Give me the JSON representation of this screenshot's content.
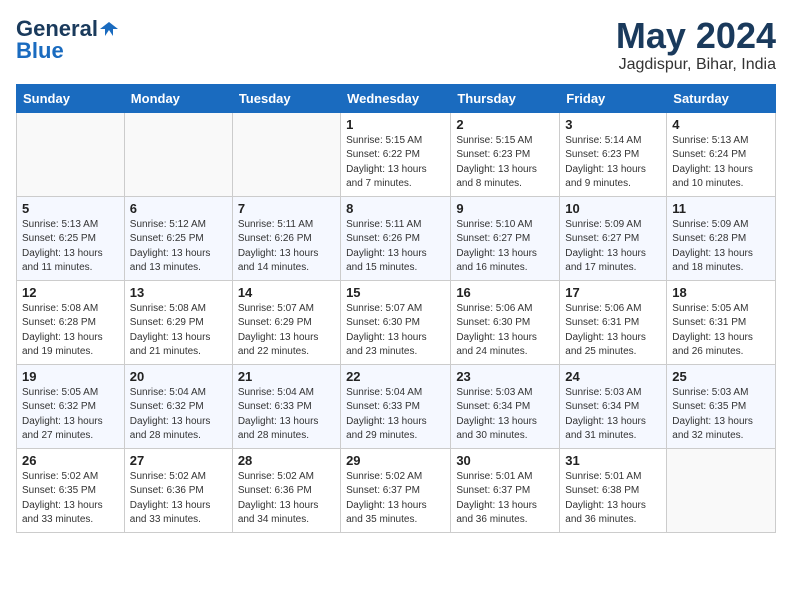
{
  "logo": {
    "line1": "General",
    "line2": "Blue"
  },
  "title": {
    "month_year": "May 2024",
    "location": "Jagdispur, Bihar, India"
  },
  "days_of_week": [
    "Sunday",
    "Monday",
    "Tuesday",
    "Wednesday",
    "Thursday",
    "Friday",
    "Saturday"
  ],
  "weeks": [
    [
      {
        "day": "",
        "info": ""
      },
      {
        "day": "",
        "info": ""
      },
      {
        "day": "",
        "info": ""
      },
      {
        "day": "1",
        "info": "Sunrise: 5:15 AM\nSunset: 6:22 PM\nDaylight: 13 hours\nand 7 minutes."
      },
      {
        "day": "2",
        "info": "Sunrise: 5:15 AM\nSunset: 6:23 PM\nDaylight: 13 hours\nand 8 minutes."
      },
      {
        "day": "3",
        "info": "Sunrise: 5:14 AM\nSunset: 6:23 PM\nDaylight: 13 hours\nand 9 minutes."
      },
      {
        "day": "4",
        "info": "Sunrise: 5:13 AM\nSunset: 6:24 PM\nDaylight: 13 hours\nand 10 minutes."
      }
    ],
    [
      {
        "day": "5",
        "info": "Sunrise: 5:13 AM\nSunset: 6:25 PM\nDaylight: 13 hours\nand 11 minutes."
      },
      {
        "day": "6",
        "info": "Sunrise: 5:12 AM\nSunset: 6:25 PM\nDaylight: 13 hours\nand 13 minutes."
      },
      {
        "day": "7",
        "info": "Sunrise: 5:11 AM\nSunset: 6:26 PM\nDaylight: 13 hours\nand 14 minutes."
      },
      {
        "day": "8",
        "info": "Sunrise: 5:11 AM\nSunset: 6:26 PM\nDaylight: 13 hours\nand 15 minutes."
      },
      {
        "day": "9",
        "info": "Sunrise: 5:10 AM\nSunset: 6:27 PM\nDaylight: 13 hours\nand 16 minutes."
      },
      {
        "day": "10",
        "info": "Sunrise: 5:09 AM\nSunset: 6:27 PM\nDaylight: 13 hours\nand 17 minutes."
      },
      {
        "day": "11",
        "info": "Sunrise: 5:09 AM\nSunset: 6:28 PM\nDaylight: 13 hours\nand 18 minutes."
      }
    ],
    [
      {
        "day": "12",
        "info": "Sunrise: 5:08 AM\nSunset: 6:28 PM\nDaylight: 13 hours\nand 19 minutes."
      },
      {
        "day": "13",
        "info": "Sunrise: 5:08 AM\nSunset: 6:29 PM\nDaylight: 13 hours\nand 21 minutes."
      },
      {
        "day": "14",
        "info": "Sunrise: 5:07 AM\nSunset: 6:29 PM\nDaylight: 13 hours\nand 22 minutes."
      },
      {
        "day": "15",
        "info": "Sunrise: 5:07 AM\nSunset: 6:30 PM\nDaylight: 13 hours\nand 23 minutes."
      },
      {
        "day": "16",
        "info": "Sunrise: 5:06 AM\nSunset: 6:30 PM\nDaylight: 13 hours\nand 24 minutes."
      },
      {
        "day": "17",
        "info": "Sunrise: 5:06 AM\nSunset: 6:31 PM\nDaylight: 13 hours\nand 25 minutes."
      },
      {
        "day": "18",
        "info": "Sunrise: 5:05 AM\nSunset: 6:31 PM\nDaylight: 13 hours\nand 26 minutes."
      }
    ],
    [
      {
        "day": "19",
        "info": "Sunrise: 5:05 AM\nSunset: 6:32 PM\nDaylight: 13 hours\nand 27 minutes."
      },
      {
        "day": "20",
        "info": "Sunrise: 5:04 AM\nSunset: 6:32 PM\nDaylight: 13 hours\nand 28 minutes."
      },
      {
        "day": "21",
        "info": "Sunrise: 5:04 AM\nSunset: 6:33 PM\nDaylight: 13 hours\nand 28 minutes."
      },
      {
        "day": "22",
        "info": "Sunrise: 5:04 AM\nSunset: 6:33 PM\nDaylight: 13 hours\nand 29 minutes."
      },
      {
        "day": "23",
        "info": "Sunrise: 5:03 AM\nSunset: 6:34 PM\nDaylight: 13 hours\nand 30 minutes."
      },
      {
        "day": "24",
        "info": "Sunrise: 5:03 AM\nSunset: 6:34 PM\nDaylight: 13 hours\nand 31 minutes."
      },
      {
        "day": "25",
        "info": "Sunrise: 5:03 AM\nSunset: 6:35 PM\nDaylight: 13 hours\nand 32 minutes."
      }
    ],
    [
      {
        "day": "26",
        "info": "Sunrise: 5:02 AM\nSunset: 6:35 PM\nDaylight: 13 hours\nand 33 minutes."
      },
      {
        "day": "27",
        "info": "Sunrise: 5:02 AM\nSunset: 6:36 PM\nDaylight: 13 hours\nand 33 minutes."
      },
      {
        "day": "28",
        "info": "Sunrise: 5:02 AM\nSunset: 6:36 PM\nDaylight: 13 hours\nand 34 minutes."
      },
      {
        "day": "29",
        "info": "Sunrise: 5:02 AM\nSunset: 6:37 PM\nDaylight: 13 hours\nand 35 minutes."
      },
      {
        "day": "30",
        "info": "Sunrise: 5:01 AM\nSunset: 6:37 PM\nDaylight: 13 hours\nand 36 minutes."
      },
      {
        "day": "31",
        "info": "Sunrise: 5:01 AM\nSunset: 6:38 PM\nDaylight: 13 hours\nand 36 minutes."
      },
      {
        "day": "",
        "info": ""
      }
    ]
  ]
}
